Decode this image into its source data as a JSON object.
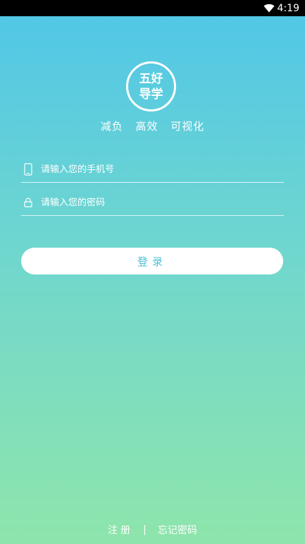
{
  "status_bar": {
    "time": "4:19",
    "wifi_icon": "wifi-icon"
  },
  "logo": {
    "line1": "五好",
    "line2": "导学"
  },
  "tagline": [
    "减负",
    "高效",
    "可视化"
  ],
  "form": {
    "phone": {
      "placeholder": "请输入您的手机号",
      "value": "",
      "icon": "phone-icon"
    },
    "password": {
      "placeholder": "请输入您的密码",
      "value": "",
      "icon": "lock-icon"
    }
  },
  "login_label": "登录",
  "footer": {
    "register_label": "注册",
    "divider": "|",
    "forgot_password_label": "忘记密码"
  },
  "colors": {
    "gradient_top": "#4fc6e8",
    "gradient_bottom": "#8ee5ab",
    "button_text": "#4fbfd6"
  }
}
